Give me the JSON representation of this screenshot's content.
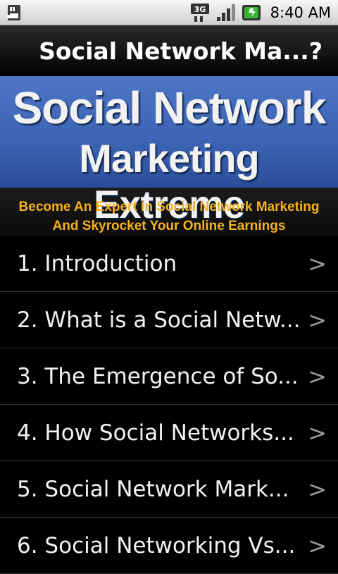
{
  "status_bar": {
    "time": "8:40 AM",
    "network_label": "3G"
  },
  "title_bar": {
    "title": "Social Network Ma...?"
  },
  "banner": {
    "line1": "Social Network",
    "line2": "Marketing Extreme",
    "sub1": "Become An Expert In Social Network Marketing",
    "sub2": "And Skyrocket Your Online Earnings"
  },
  "chapters": [
    {
      "label": "1. Introduction",
      "chevron": ">"
    },
    {
      "label": "2. What is a Social Netw...",
      "chevron": ">"
    },
    {
      "label": "3. The Emergence of So...",
      "chevron": ">"
    },
    {
      "label": "4. How Social Networks...",
      "chevron": ">"
    },
    {
      "label": "5. Social Network Mark...",
      "chevron": ">"
    },
    {
      "label": "6. Social Networking Vs...",
      "chevron": ">"
    }
  ]
}
